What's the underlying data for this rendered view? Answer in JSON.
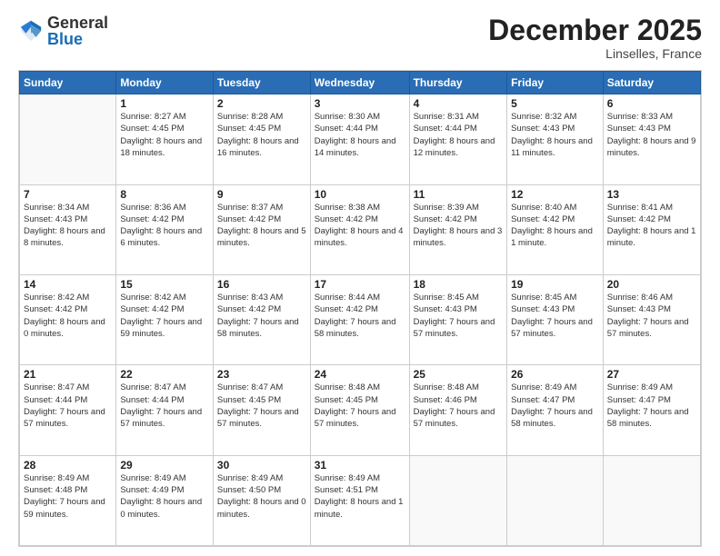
{
  "header": {
    "logo_general": "General",
    "logo_blue": "Blue",
    "month_title": "December 2025",
    "location": "Linselles, France"
  },
  "days": [
    "Sunday",
    "Monday",
    "Tuesday",
    "Wednesday",
    "Thursday",
    "Friday",
    "Saturday"
  ],
  "weeks": [
    [
      {
        "day": "",
        "info": ""
      },
      {
        "day": "1",
        "info": "Sunrise: 8:27 AM\nSunset: 4:45 PM\nDaylight: 8 hours\nand 18 minutes."
      },
      {
        "day": "2",
        "info": "Sunrise: 8:28 AM\nSunset: 4:45 PM\nDaylight: 8 hours\nand 16 minutes."
      },
      {
        "day": "3",
        "info": "Sunrise: 8:30 AM\nSunset: 4:44 PM\nDaylight: 8 hours\nand 14 minutes."
      },
      {
        "day": "4",
        "info": "Sunrise: 8:31 AM\nSunset: 4:44 PM\nDaylight: 8 hours\nand 12 minutes."
      },
      {
        "day": "5",
        "info": "Sunrise: 8:32 AM\nSunset: 4:43 PM\nDaylight: 8 hours\nand 11 minutes."
      },
      {
        "day": "6",
        "info": "Sunrise: 8:33 AM\nSunset: 4:43 PM\nDaylight: 8 hours\nand 9 minutes."
      }
    ],
    [
      {
        "day": "7",
        "info": "Sunrise: 8:34 AM\nSunset: 4:43 PM\nDaylight: 8 hours\nand 8 minutes."
      },
      {
        "day": "8",
        "info": "Sunrise: 8:36 AM\nSunset: 4:42 PM\nDaylight: 8 hours\nand 6 minutes."
      },
      {
        "day": "9",
        "info": "Sunrise: 8:37 AM\nSunset: 4:42 PM\nDaylight: 8 hours\nand 5 minutes."
      },
      {
        "day": "10",
        "info": "Sunrise: 8:38 AM\nSunset: 4:42 PM\nDaylight: 8 hours\nand 4 minutes."
      },
      {
        "day": "11",
        "info": "Sunrise: 8:39 AM\nSunset: 4:42 PM\nDaylight: 8 hours\nand 3 minutes."
      },
      {
        "day": "12",
        "info": "Sunrise: 8:40 AM\nSunset: 4:42 PM\nDaylight: 8 hours\nand 1 minute."
      },
      {
        "day": "13",
        "info": "Sunrise: 8:41 AM\nSunset: 4:42 PM\nDaylight: 8 hours\nand 1 minute."
      }
    ],
    [
      {
        "day": "14",
        "info": "Sunrise: 8:42 AM\nSunset: 4:42 PM\nDaylight: 8 hours\nand 0 minutes."
      },
      {
        "day": "15",
        "info": "Sunrise: 8:42 AM\nSunset: 4:42 PM\nDaylight: 7 hours\nand 59 minutes."
      },
      {
        "day": "16",
        "info": "Sunrise: 8:43 AM\nSunset: 4:42 PM\nDaylight: 7 hours\nand 58 minutes."
      },
      {
        "day": "17",
        "info": "Sunrise: 8:44 AM\nSunset: 4:42 PM\nDaylight: 7 hours\nand 58 minutes."
      },
      {
        "day": "18",
        "info": "Sunrise: 8:45 AM\nSunset: 4:43 PM\nDaylight: 7 hours\nand 57 minutes."
      },
      {
        "day": "19",
        "info": "Sunrise: 8:45 AM\nSunset: 4:43 PM\nDaylight: 7 hours\nand 57 minutes."
      },
      {
        "day": "20",
        "info": "Sunrise: 8:46 AM\nSunset: 4:43 PM\nDaylight: 7 hours\nand 57 minutes."
      }
    ],
    [
      {
        "day": "21",
        "info": "Sunrise: 8:47 AM\nSunset: 4:44 PM\nDaylight: 7 hours\nand 57 minutes."
      },
      {
        "day": "22",
        "info": "Sunrise: 8:47 AM\nSunset: 4:44 PM\nDaylight: 7 hours\nand 57 minutes."
      },
      {
        "day": "23",
        "info": "Sunrise: 8:47 AM\nSunset: 4:45 PM\nDaylight: 7 hours\nand 57 minutes."
      },
      {
        "day": "24",
        "info": "Sunrise: 8:48 AM\nSunset: 4:45 PM\nDaylight: 7 hours\nand 57 minutes."
      },
      {
        "day": "25",
        "info": "Sunrise: 8:48 AM\nSunset: 4:46 PM\nDaylight: 7 hours\nand 57 minutes."
      },
      {
        "day": "26",
        "info": "Sunrise: 8:49 AM\nSunset: 4:47 PM\nDaylight: 7 hours\nand 58 minutes."
      },
      {
        "day": "27",
        "info": "Sunrise: 8:49 AM\nSunset: 4:47 PM\nDaylight: 7 hours\nand 58 minutes."
      }
    ],
    [
      {
        "day": "28",
        "info": "Sunrise: 8:49 AM\nSunset: 4:48 PM\nDaylight: 7 hours\nand 59 minutes."
      },
      {
        "day": "29",
        "info": "Sunrise: 8:49 AM\nSunset: 4:49 PM\nDaylight: 8 hours\nand 0 minutes."
      },
      {
        "day": "30",
        "info": "Sunrise: 8:49 AM\nSunset: 4:50 PM\nDaylight: 8 hours\nand 0 minutes."
      },
      {
        "day": "31",
        "info": "Sunrise: 8:49 AM\nSunset: 4:51 PM\nDaylight: 8 hours\nand 1 minute."
      },
      {
        "day": "",
        "info": ""
      },
      {
        "day": "",
        "info": ""
      },
      {
        "day": "",
        "info": ""
      }
    ]
  ]
}
